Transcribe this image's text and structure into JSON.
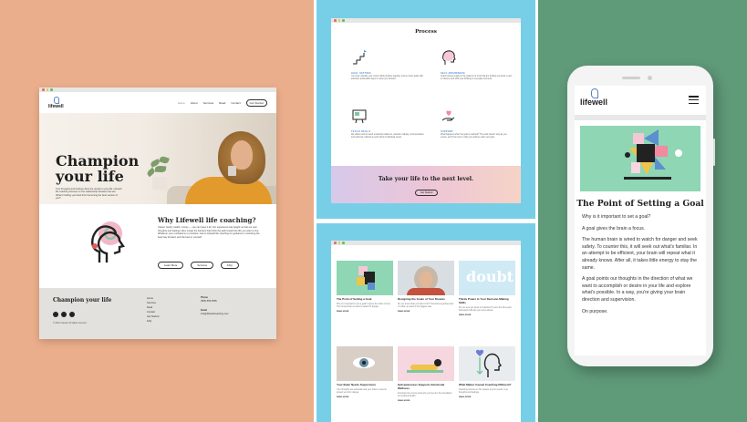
{
  "colors": {
    "peach": "#ebae8c",
    "sky": "#77cfe7",
    "green": "#5f9a79",
    "brand_blue": "#5a83c4"
  },
  "site1": {
    "logo": "lifewell",
    "nav": [
      "Home",
      "About",
      "Services",
      "Read",
      "Contact"
    ],
    "nav_button": "Get Started",
    "hero_title_line1": "Champion",
    "hero_title_line2": "your life",
    "hero_body": "Your thoughts and feelings drive the results in your life. Lifewell life coaching focuses on the relationship between the two. What's holding you back from becoming the best version of you?",
    "why_title": "Why Lifewell life coaching?",
    "why_body": "Career, family, health, money — you can have it all. Our experience has taught us that our own thoughts and feelings often create the barriers that block the path toward the life you want to live. Whatever your motivations or priorities, look to Lifewell life coaching for guidance in unlocking the best way forward, and the best in yourself.",
    "buttons": [
      "Learn More",
      "Services",
      "FAQ"
    ],
    "footer": {
      "title": "Champion your life",
      "copyright": "© 2021 Lifewell. All rights reserved.",
      "links": [
        "Home",
        "Services",
        "Read",
        "Contact",
        "Get Started",
        "FAQ"
      ],
      "phone_label": "Phone",
      "phone": "(555) 555-5555",
      "email_label": "Email",
      "email": "info@lifewellcoaching.com"
    }
  },
  "site2": {
    "process_title": "Process",
    "steps": [
      {
        "label": "GOAL SETTING",
        "text": "Your and I identify your most fruitful priorities together and set clear goals with practical, achievable steps to move you forward."
      },
      {
        "label": "SELF-AWARENESS",
        "text": "Coach shines a light on the patterns of mind that are holding you back. Learn to observe and shift your thinking in everyday moments."
      },
      {
        "label": "TEACH SKILLS",
        "text": "We utilize tools to teach emotional resilience, decision making, communication and self-trust, tailored to each client's individual needs."
      },
      {
        "label": "SUPPORT",
        "text": "What happens when the goal is reached? The work doesn't stop as you evolve, and I'll be here to help you achieve each new goal."
      }
    ],
    "cta_title": "Take your life to the next level.",
    "cta_button": "Get Started"
  },
  "site3": {
    "cards": [
      {
        "title": "The Point of Setting a Goal",
        "text": "Why is it important to set a goal? It gives the brain a focus. The human brain is wired to watch for danger.",
        "more": "READ MORE"
      },
      {
        "title": "Designing the Goals of Your Dreams",
        "text": "Do you know what you want in life? Sometimes getting clear on what you want is the biggest step.",
        "more": "READ MORE"
      },
      {
        "title": "Thirds Power in Your Decision-Making Skills",
        "text": "Do you ever get stuck in indecision? Learn the three-part framework that lets you move ahead.",
        "more": "READ MORE"
      },
      {
        "title": "Your Brain Needs Supervision",
        "text": "Your thoughts are automatic and your brain is wired to protect you from danger.",
        "more": "READ MORE"
      },
      {
        "title": "Self-awareness Supports Emotional Wellness",
        "text": "Knowing how you feel and why you feel it is the foundation of emotional health.",
        "more": "READ MORE"
      },
      {
        "title": "What Makes Causal Coaching Different?",
        "text": "Coaching focuses on the causes of your results: your thoughts and feelings.",
        "more": "READ MORE"
      }
    ],
    "doubt_word": "doubt"
  },
  "mobile": {
    "logo": "lifewell",
    "headline": "The Point of Setting a Goal",
    "paragraphs": [
      "Why is it important to set a goal?",
      "A goal gives the brain a focus.",
      "The human brain is wired to watch for danger and seek safety. To counter this, it will seek out what's familiar. In an attempt to be efficient, your brain will repeat what it already knows. After all, it takes little energy to stay the same.",
      "A goal points our thoughts in the direction of what we want to accomplish or desire in your life and explore what's possible. In a way, you're giving your brain direction and supervision.",
      "On purpose."
    ]
  }
}
